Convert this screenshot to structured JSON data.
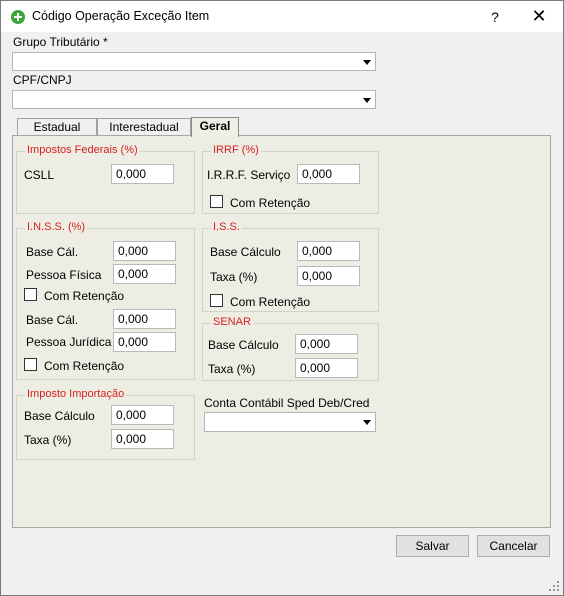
{
  "window": {
    "title": "Código Operação Exceção Item",
    "help": "?",
    "close": "✕"
  },
  "grupo_tributario": {
    "label": "Grupo Tributário *",
    "value": ""
  },
  "cpf_cnpj": {
    "label": "CPF/CNPJ",
    "value": ""
  },
  "tabs": [
    {
      "label": "Estadual"
    },
    {
      "label": "Interestadual"
    },
    {
      "label": "Geral"
    }
  ],
  "impostos_federais": {
    "title": "Impostos Federais (%)",
    "csll_label": "CSLL",
    "csll_value": "0,000"
  },
  "irrf": {
    "title": "IRRF (%)",
    "servico_label": "I.R.R.F. Serviço",
    "servico_value": "0,000",
    "retencao_label": "Com Retenção"
  },
  "inss": {
    "title": "I.N.S.S. (%)",
    "base_cal_pf_label": "Base Cál.",
    "base_cal_pf_value": "0,000",
    "pessoa_fisica_label": "Pessoa Física",
    "pessoa_fisica_value": "0,000",
    "retencao_pf_label": "Com Retenção",
    "base_cal_pj_label": "Base Cál.",
    "base_cal_pj_value": "0,000",
    "pessoa_juridica_label": "Pessoa Jurídica",
    "pessoa_juridica_value": "0,000",
    "retencao_pj_label": "Com Retenção"
  },
  "iss": {
    "title": "I.S.S.",
    "base_label": "Base Cálculo",
    "base_value": "0,000",
    "taxa_label": "Taxa (%)",
    "taxa_value": "0,000",
    "retencao_label": "Com Retenção"
  },
  "senar": {
    "title": "SENAR",
    "base_label": "Base Cálculo",
    "base_value": "0,000",
    "taxa_label": "Taxa (%)",
    "taxa_value": "0,000"
  },
  "imposto_importacao": {
    "title": "Imposto Importação",
    "base_label": "Base Cálculo",
    "base_value": "0,000",
    "taxa_label": "Taxa (%)",
    "taxa_value": "0,000"
  },
  "conta_contabil": {
    "label": "Conta Contábil Sped Deb/Cred",
    "value": ""
  },
  "buttons": {
    "salvar": "Salvar",
    "cancelar": "Cancelar"
  }
}
